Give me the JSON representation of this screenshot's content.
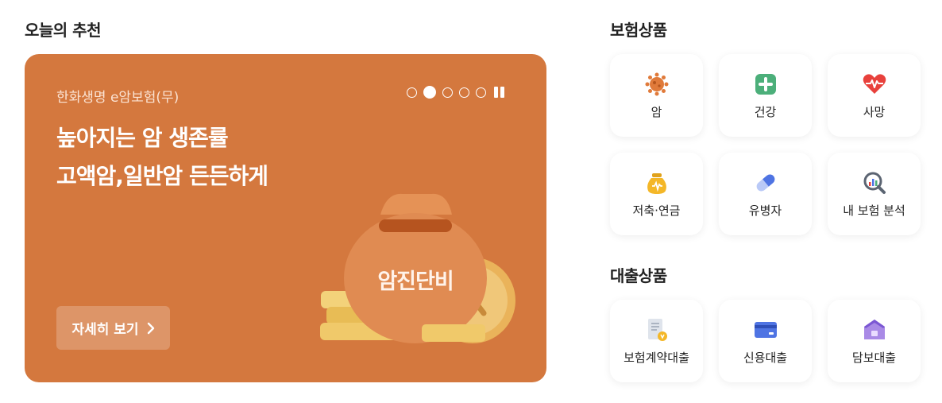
{
  "today": {
    "title": "오늘의 추천",
    "banner": {
      "product": "한화생명 e암보험(무)",
      "headline_line1": "높아지는 암 생존률",
      "headline_line2": "고액암,일반암 든든하게",
      "detail_label": "자세히 보기",
      "bag_text": "암진단비",
      "slide_count": 5,
      "active_slide": 2,
      "bg_color": "#d4783e"
    }
  },
  "insurance": {
    "title": "보험상품",
    "items": [
      {
        "label": "암",
        "icon": "virus-icon"
      },
      {
        "label": "건강",
        "icon": "medical-cross-icon"
      },
      {
        "label": "사망",
        "icon": "heart-pulse-icon"
      },
      {
        "label": "저축·연금",
        "icon": "money-pouch-icon"
      },
      {
        "label": "유병자",
        "icon": "pill-icon"
      },
      {
        "label": "내 보험 분석",
        "icon": "magnifier-chart-icon"
      }
    ]
  },
  "loan": {
    "title": "대출상품",
    "items": [
      {
        "label": "보험계약대출",
        "icon": "document-coin-icon"
      },
      {
        "label": "신용대출",
        "icon": "credit-card-icon"
      },
      {
        "label": "담보대출",
        "icon": "house-icon"
      }
    ]
  }
}
